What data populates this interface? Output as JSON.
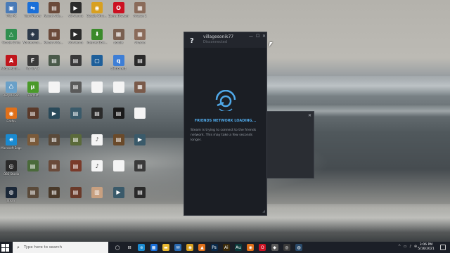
{
  "desktop": {
    "icons": [
      {
        "label": "This PC",
        "color": "#4a7bb7",
        "glyph": "▣",
        "col": 0,
        "row": 0
      },
      {
        "label": "TeamViewer",
        "color": "#1a6fd8",
        "glyph": "⇆",
        "col": 1,
        "row": 0
      },
      {
        "label": "Recent videos 2019 08",
        "color": "#6b4a3a",
        "glyph": "▤",
        "col": 2,
        "row": 0
      },
      {
        "label": "vid-vienna",
        "color": "#2b2b2b",
        "glyph": "▶",
        "col": 3,
        "row": 0
      },
      {
        "label": "Google Chrome",
        "color": "#d8a020",
        "glyph": "◉",
        "col": 4,
        "row": 0
      },
      {
        "label": "Opera Browser",
        "color": "#cc1122",
        "glyph": "O",
        "col": 5,
        "row": 0
      },
      {
        "label": "vinasce 1",
        "color": "#8a6b5a",
        "glyph": "▦",
        "col": 6,
        "row": 0
      },
      {
        "label": "Google Drive",
        "color": "#2f8f4f",
        "glyph": "△",
        "col": 0,
        "row": 1
      },
      {
        "label": "Wondershare Filmora 9",
        "color": "#2d3a4a",
        "glyph": "◈",
        "col": 1,
        "row": 1
      },
      {
        "label": "Recent videos 2019 09",
        "color": "#6b4a3a",
        "glyph": "▤",
        "col": 2,
        "row": 1
      },
      {
        "label": "vid-vienna",
        "color": "#2b2b2b",
        "glyph": "▶",
        "col": 3,
        "row": 1
      },
      {
        "label": "Internet Downloa...",
        "color": "#3a8a2a",
        "glyph": "⬇",
        "col": 4,
        "row": 1
      },
      {
        "label": "google",
        "color": "#7a6050",
        "glyph": "▦",
        "col": 5,
        "row": 1
      },
      {
        "label": "vinasce",
        "color": "#8a6b5a",
        "glyph": "▦",
        "col": 6,
        "row": 1
      },
      {
        "label": "Adobe Applicati...",
        "color": "#c0161c",
        "glyph": "A",
        "col": 0,
        "row": 2
      },
      {
        "label": "Far Cry 3",
        "color": "#3a3a3a",
        "glyph": "F",
        "col": 1,
        "row": 2
      },
      {
        "label": "",
        "color": "#4a5a4a",
        "glyph": "▤",
        "col": 2,
        "row": 2
      },
      {
        "label": "",
        "color": "#3a3a3a",
        "glyph": "▤",
        "col": 3,
        "row": 2
      },
      {
        "label": "",
        "color": "#1e5f9a",
        "glyph": "▢",
        "col": 4,
        "row": 2
      },
      {
        "label": "qBittorrent",
        "color": "#3d7ed6",
        "glyph": "q",
        "col": 5,
        "row": 2
      },
      {
        "label": "",
        "color": "#2a2a2a",
        "glyph": "▤",
        "col": 6,
        "row": 2
      },
      {
        "label": "Recycle Bin",
        "color": "#6aa0c8",
        "glyph": "♺",
        "col": 0,
        "row": 3
      },
      {
        "label": "µTorrent",
        "color": "#4a9a2a",
        "glyph": "µ",
        "col": 1,
        "row": 3
      },
      {
        "label": "",
        "color": "#f4f4f4",
        "glyph": "",
        "col": 2,
        "row": 3
      },
      {
        "label": "",
        "color": "#5a5a5a",
        "glyph": "▤",
        "col": 3,
        "row": 3
      },
      {
        "label": "",
        "color": "#f4f4f4",
        "glyph": "",
        "col": 4,
        "row": 3
      },
      {
        "label": "",
        "color": "#f4f4f4",
        "glyph": "",
        "col": 5,
        "row": 3
      },
      {
        "label": "",
        "color": "#7a5a4a",
        "glyph": "▦",
        "col": 6,
        "row": 3
      },
      {
        "label": "Firefox",
        "color": "#e0701a",
        "glyph": "◉",
        "col": 0,
        "row": 4
      },
      {
        "label": "",
        "color": "#5a3a2a",
        "glyph": "▤",
        "col": 1,
        "row": 4
      },
      {
        "label": "",
        "color": "#2a4a5a",
        "glyph": "▶",
        "col": 2,
        "row": 4
      },
      {
        "label": "",
        "color": "#3a5a6a",
        "glyph": "▤",
        "col": 3,
        "row": 4
      },
      {
        "label": "",
        "color": "#2a2a2a",
        "glyph": "▤",
        "col": 4,
        "row": 4
      },
      {
        "label": "",
        "color": "#1a1a1a",
        "glyph": "▤",
        "col": 5,
        "row": 4
      },
      {
        "label": "",
        "color": "#f4f4f4",
        "glyph": "",
        "col": 6,
        "row": 4
      },
      {
        "label": "Microsoft Edge",
        "color": "#1a8ad0",
        "glyph": "e",
        "col": 0,
        "row": 5
      },
      {
        "label": "",
        "color": "#7a5a3a",
        "glyph": "▤",
        "col": 1,
        "row": 5
      },
      {
        "label": "",
        "color": "#5a4a3a",
        "glyph": "▤",
        "col": 2,
        "row": 5
      },
      {
        "label": "",
        "color": "#5a6a3a",
        "glyph": "▤",
        "col": 3,
        "row": 5
      },
      {
        "label": "",
        "color": "#f4f4f4",
        "glyph": "♪",
        "col": 4,
        "row": 5
      },
      {
        "label": "",
        "color": "#6a4a2a",
        "glyph": "▤",
        "col": 5,
        "row": 5
      },
      {
        "label": "",
        "color": "#3a5a6a",
        "glyph": "▶",
        "col": 6,
        "row": 5
      },
      {
        "label": "OBS Studio",
        "color": "#2a2a2a",
        "glyph": "◎",
        "col": 0,
        "row": 6
      },
      {
        "label": "",
        "color": "#4a6a3a",
        "glyph": "▤",
        "col": 1,
        "row": 6
      },
      {
        "label": "",
        "color": "#6a4a3a",
        "glyph": "▤",
        "col": 2,
        "row": 6
      },
      {
        "label": "",
        "color": "#7a3a2a",
        "glyph": "▤",
        "col": 3,
        "row": 6
      },
      {
        "label": "",
        "color": "#f4f4f4",
        "glyph": "♪",
        "col": 4,
        "row": 6
      },
      {
        "label": "",
        "color": "#f4f4f4",
        "glyph": "",
        "col": 5,
        "row": 6
      },
      {
        "label": "",
        "color": "#3a3a3a",
        "glyph": "▤",
        "col": 6,
        "row": 6
      },
      {
        "label": "Steam",
        "color": "#1b2838",
        "glyph": "◍",
        "col": 0,
        "row": 7
      },
      {
        "label": "",
        "color": "#5a4a3a",
        "glyph": "▤",
        "col": 1,
        "row": 7
      },
      {
        "label": "",
        "color": "#4a3a2a",
        "glyph": "▤",
        "col": 2,
        "row": 7
      },
      {
        "label": "",
        "color": "#6a3a2a",
        "glyph": "▤",
        "col": 3,
        "row": 7
      },
      {
        "label": "",
        "color": "#c8a080",
        "glyph": "▥",
        "col": 4,
        "row": 7
      },
      {
        "label": "",
        "color": "#3a5a6a",
        "glyph": "▶",
        "col": 5,
        "row": 7
      },
      {
        "label": "",
        "color": "#2a2a2a",
        "glyph": "▤",
        "col": 6,
        "row": 7
      }
    ]
  },
  "steam": {
    "help": "?",
    "username": "villagesonik77",
    "status": "Disconnected",
    "minimize": "—",
    "maximize": "☐",
    "close": "✕",
    "loading": "FRIENDS NETWORK LOADING...",
    "message": "Steam is trying to connect to the friends network. This may take a few seconds longer.",
    "accent": "#4fa8e8"
  },
  "behind_window": {
    "close": "✕"
  },
  "taskbar": {
    "search_placeholder": "Type here to search",
    "search_icon": "search-icon",
    "apps": [
      {
        "name": "task-view-icon",
        "glyph": "◯",
        "color": "transparent"
      },
      {
        "name": "tabs-icon",
        "glyph": "⊟",
        "color": "transparent"
      },
      {
        "name": "edge-icon",
        "glyph": "e",
        "color": "#1a8ad0"
      },
      {
        "name": "store-icon",
        "glyph": "▦",
        "color": "#1a6fd8"
      },
      {
        "name": "file-explorer-icon",
        "glyph": "▬",
        "color": "#e8b830"
      },
      {
        "name": "mail-icon",
        "glyph": "✉",
        "color": "#2a6ab0"
      },
      {
        "name": "chrome-icon",
        "glyph": "◉",
        "color": "#d8a020"
      },
      {
        "name": "vlc-icon",
        "glyph": "▲",
        "color": "#e0701a"
      },
      {
        "name": "photoshop-icon",
        "glyph": "Ps",
        "color": "#0a2a4a"
      },
      {
        "name": "illustrator-icon",
        "glyph": "Ai",
        "color": "#3a2a0a"
      },
      {
        "name": "audition-icon",
        "glyph": "Au",
        "color": "#0a3a3a"
      },
      {
        "name": "firefox-icon",
        "glyph": "◉",
        "color": "#e0701a"
      },
      {
        "name": "opera-icon",
        "glyph": "O",
        "color": "#cc1122"
      },
      {
        "name": "media-icon",
        "glyph": "◆",
        "color": "#5a5a5a"
      },
      {
        "name": "obs-icon",
        "glyph": "◎",
        "color": "#3a3a3a"
      },
      {
        "name": "steam-icon",
        "glyph": "◍",
        "color": "#2a4a6a"
      }
    ],
    "tray": "^ ▭ ♪ ⊕",
    "time": "3:06 PM",
    "date": "5/16/2021"
  }
}
